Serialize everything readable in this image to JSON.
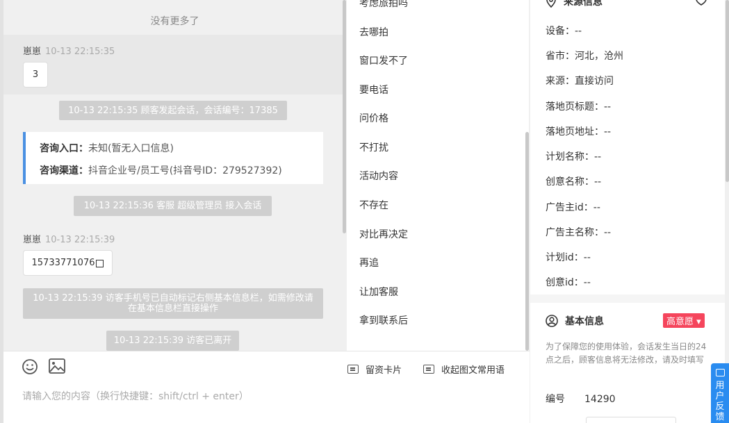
{
  "chat": {
    "no_more": "没有更多了",
    "messages": [
      {
        "sender": "崽崽",
        "time": "10-13 22:15:35",
        "text": "3"
      },
      {
        "sender": "崽崽",
        "time": "10-13 22:15:39",
        "text": "15733771076"
      }
    ],
    "system": [
      "10-13 22:15:35 顾客发起会话，会话编号：17385",
      "10-13 22:15:36 客服 超级管理员 接入会话",
      "10-13 22:15:39 访客手机号已自动标记右侧基本信息栏，如需修改请在基本信息栏直接操作",
      "10-13 22:15:39 访客已离开"
    ],
    "info_card": {
      "entry_label": "咨询入口：",
      "entry_value": "未知(暂无入口信息)",
      "channel_label": "咨询渠道：",
      "channel_value": "抖音企业号/员工号(抖音号ID：279527392)"
    }
  },
  "quick_replies": [
    "考虑旅拍吗",
    "去哪拍",
    "窗口发不了",
    "要电话",
    "问价格",
    "不打扰",
    "活动内容",
    "不存在",
    "对比再决定",
    "再追",
    "让加客服",
    "拿到联系后"
  ],
  "input": {
    "placeholder": "请输入您的内容（换行快捷键：shift/ctrl + enter）",
    "card_label": "留资卡片",
    "collapse_label": "收起图文常用语",
    "emoji_icon": "smiley-icon",
    "image_icon": "image-icon"
  },
  "source_info": {
    "title": "来源信息",
    "rows": [
      {
        "label": "设备：",
        "value": "--"
      },
      {
        "label": "省市：",
        "value": "河北，沧州"
      },
      {
        "label": "来源：",
        "value": "直接访问"
      },
      {
        "label": "落地页标题：",
        "value": "--"
      },
      {
        "label": "落地页地址：",
        "value": "--"
      },
      {
        "label": "计划名称：",
        "value": "--"
      },
      {
        "label": "创意名称：",
        "value": "--"
      },
      {
        "label": "广告主id：",
        "value": "--"
      },
      {
        "label": "广告主名称：",
        "value": "--"
      },
      {
        "label": "计划id：",
        "value": "--"
      },
      {
        "label": "创意id：",
        "value": "--"
      }
    ]
  },
  "basic_info": {
    "title": "基本信息",
    "badge": "高意愿",
    "note": "为了保障您的使用体验，会话发生当日的24点之后，顾客信息将无法修改，请及时填写",
    "number_label": "编号",
    "number_value": "14290"
  },
  "feedback": {
    "label": "用户反馈"
  },
  "colors": {
    "accent": "#4a90e2",
    "badge": "#f5455c",
    "feedback": "#2a8cf0"
  }
}
